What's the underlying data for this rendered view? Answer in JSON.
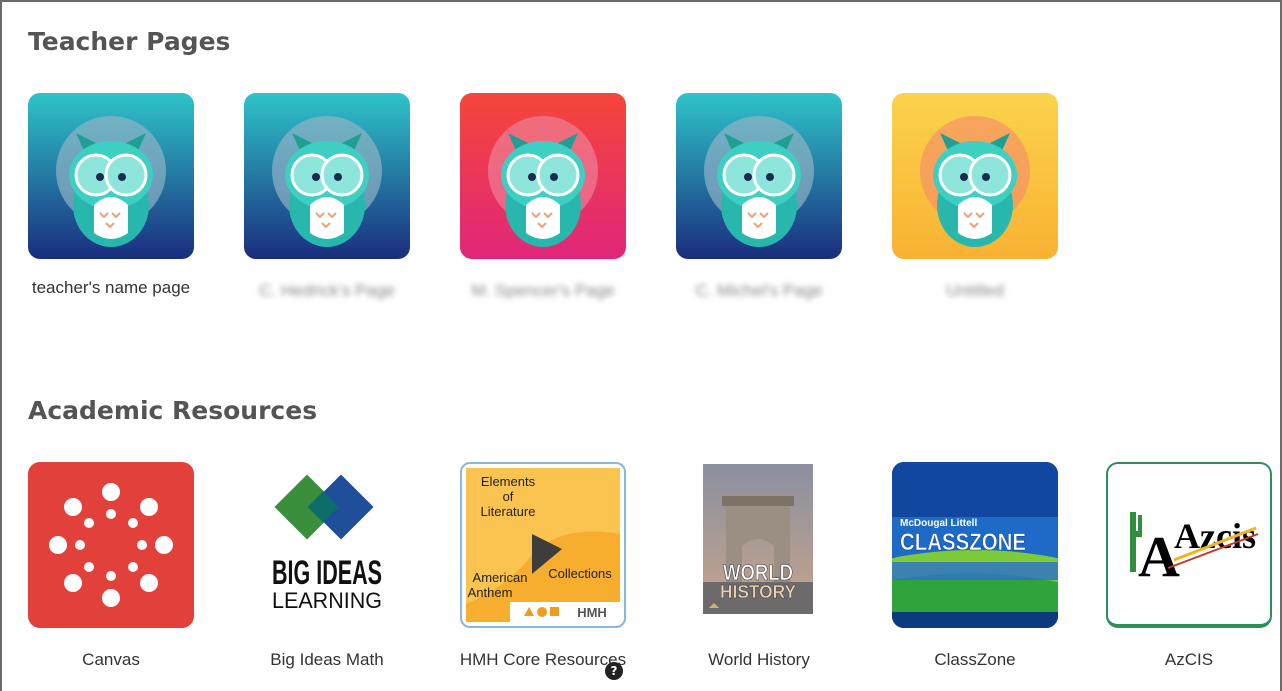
{
  "sections": {
    "teacher": {
      "title": "Teacher Pages",
      "items": [
        {
          "label": "teacher's name page",
          "colors": [
            "#2ec4c9",
            "#1b2d7e"
          ]
        },
        {
          "label": "C. Hedrick's Page",
          "colors": [
            "#2ec4c9",
            "#1b2d7e"
          ]
        },
        {
          "label": "M. Spencer's Page",
          "colors": [
            "#f5463a",
            "#e0267a"
          ]
        },
        {
          "label": "C. Michel's Page",
          "colors": [
            "#2ec4c9",
            "#1b2d7e"
          ]
        },
        {
          "label": "Untitled",
          "colors": [
            "#f9b233",
            "#fbd24c"
          ]
        }
      ]
    },
    "academic": {
      "title": "Academic Resources",
      "items": [
        {
          "label": "Canvas"
        },
        {
          "label": "Big Ideas Math",
          "logo_line1": "BIG IDEAS",
          "logo_line2": "LEARNING"
        },
        {
          "label": "HMH Core Resources",
          "logo_texts": [
            "Elements",
            "of",
            "Literature",
            "American",
            "Anthem",
            "Collections",
            "HMH"
          ]
        },
        {
          "label": "World History",
          "logo_line1": "WORLD",
          "logo_line2": "HISTORY"
        },
        {
          "label": "ClassZone",
          "logo_small": "McDougal Littell",
          "logo_main": "CLASSZONE"
        },
        {
          "label": "AzCIS",
          "logo_main": "Azcis",
          "logo_big_letter": "A"
        }
      ]
    }
  },
  "icons": {
    "help": "?"
  }
}
